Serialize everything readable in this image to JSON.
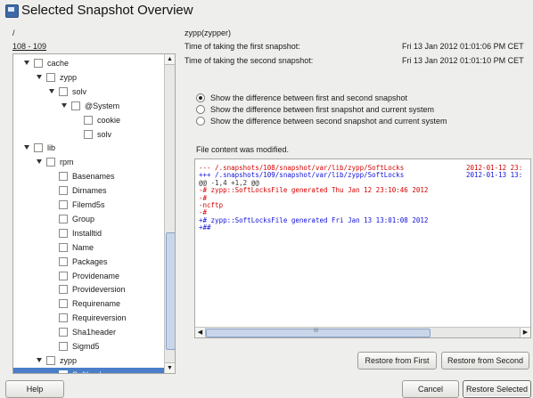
{
  "window": {
    "title": "Selected Snapshot Overview",
    "icon": "snapshot-window-icon"
  },
  "left": {
    "path": "/",
    "range": "108 - 109"
  },
  "info": {
    "snapshot_name": "zypp(zypper)",
    "first_label": "Time of taking the first snapshot:",
    "first_value": "Fri 13 Jan 2012 01:01:06 PM CET",
    "second_label": "Time of taking the second snapshot:",
    "second_value": "Fri 13 Jan 2012 01:01:10 PM CET"
  },
  "tree": [
    {
      "label": "cache",
      "level": 1,
      "expandable": true,
      "selected": false
    },
    {
      "label": "zypp",
      "level": 2,
      "expandable": true,
      "selected": false
    },
    {
      "label": "solv",
      "level": 3,
      "expandable": true,
      "selected": false
    },
    {
      "label": "@System",
      "level": 4,
      "expandable": true,
      "selected": false
    },
    {
      "label": "cookie",
      "level": 5,
      "expandable": false,
      "selected": false
    },
    {
      "label": "solv",
      "level": 5,
      "expandable": false,
      "selected": false
    },
    {
      "label": "lib",
      "level": 1,
      "expandable": true,
      "selected": false
    },
    {
      "label": "rpm",
      "level": 2,
      "expandable": true,
      "selected": false
    },
    {
      "label": "Basenames",
      "level": 3,
      "expandable": false,
      "selected": false
    },
    {
      "label": "Dirnames",
      "level": 3,
      "expandable": false,
      "selected": false
    },
    {
      "label": "Filemd5s",
      "level": 3,
      "expandable": false,
      "selected": false
    },
    {
      "label": "Group",
      "level": 3,
      "expandable": false,
      "selected": false
    },
    {
      "label": "Installtid",
      "level": 3,
      "expandable": false,
      "selected": false
    },
    {
      "label": "Name",
      "level": 3,
      "expandable": false,
      "selected": false
    },
    {
      "label": "Packages",
      "level": 3,
      "expandable": false,
      "selected": false
    },
    {
      "label": "Providename",
      "level": 3,
      "expandable": false,
      "selected": false
    },
    {
      "label": "Provideversion",
      "level": 3,
      "expandable": false,
      "selected": false
    },
    {
      "label": "Requirename",
      "level": 3,
      "expandable": false,
      "selected": false
    },
    {
      "label": "Requireversion",
      "level": 3,
      "expandable": false,
      "selected": false
    },
    {
      "label": "Sha1header",
      "level": 3,
      "expandable": false,
      "selected": false
    },
    {
      "label": "Sigmd5",
      "level": 3,
      "expandable": false,
      "selected": false
    },
    {
      "label": "zypp",
      "level": 2,
      "expandable": true,
      "selected": false
    },
    {
      "label": "SoftLocks",
      "level": 3,
      "expandable": false,
      "selected": true
    }
  ],
  "radios": [
    {
      "label": "Show the difference between first and second snapshot",
      "checked": true
    },
    {
      "label": "Show the difference between first snapshot and current system",
      "checked": false
    },
    {
      "label": "Show the difference between second snapshot and current system",
      "checked": false
    }
  ],
  "diff": {
    "status": "File content was modified.",
    "lines": [
      {
        "text": "--- /.snapshots/108/snapshot/var/lib/zypp/SoftLocks",
        "date": "2012-01-12 23:",
        "color": "red"
      },
      {
        "text": "+++ /.snapshots/109/snapshot/var/lib/zypp/SoftLocks",
        "date": "2012-01-13 13:",
        "color": "blue"
      },
      {
        "text": "@@ -1,4 +1,2 @@",
        "date": "",
        "color": "dark"
      },
      {
        "text": "-# zypp::SoftLocksFile generated Thu Jan 12 23:10:46 2012",
        "date": "",
        "color": "red"
      },
      {
        "text": "-#",
        "date": "",
        "color": "red"
      },
      {
        "text": "-ncftp",
        "date": "",
        "color": "red"
      },
      {
        "text": "-#",
        "date": "",
        "color": "red"
      },
      {
        "text": "+# zypp::SoftLocksFile generated Fri Jan 13 13:01:08 2012",
        "date": "",
        "color": "blue"
      },
      {
        "text": "+##",
        "date": "",
        "color": "blue"
      }
    ],
    "scroll_grip": "III"
  },
  "buttons": {
    "restore_first": "Restore from First",
    "restore_second": "Restore from Second",
    "help": "Help",
    "cancel": "Cancel",
    "restore_selected": "Restore Selected"
  },
  "colors": {
    "selection": "#4a7ec9",
    "removed": "#d40000",
    "added": "#1010d8"
  }
}
